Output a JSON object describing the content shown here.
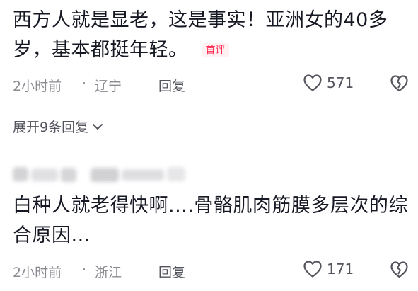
{
  "comments": [
    {
      "text": "西方人就是显老，这是事实！亚洲女的40多岁，基本都挺年轻。",
      "badge": "首评",
      "time": "2小时前",
      "separator": "·",
      "location": "辽宁",
      "reply_label": "回复",
      "like_count": "571",
      "expand_label": "展开9条回复"
    },
    {
      "text": "白种人就老得快啊....骨骼肌肉筋膜多层次的综合原因...",
      "time": "2小时前",
      "separator": "·",
      "location": "浙江",
      "reply_label": "回复",
      "like_count": "171"
    }
  ],
  "colors": {
    "text": "#161823",
    "meta": "#8a8b91",
    "badge": "#fe2c55",
    "badge_bg": "#fff0f2"
  },
  "icons": {
    "like": "heart-outline-icon",
    "dislike": "broken-heart-icon",
    "expand": "chevron-down-icon"
  }
}
